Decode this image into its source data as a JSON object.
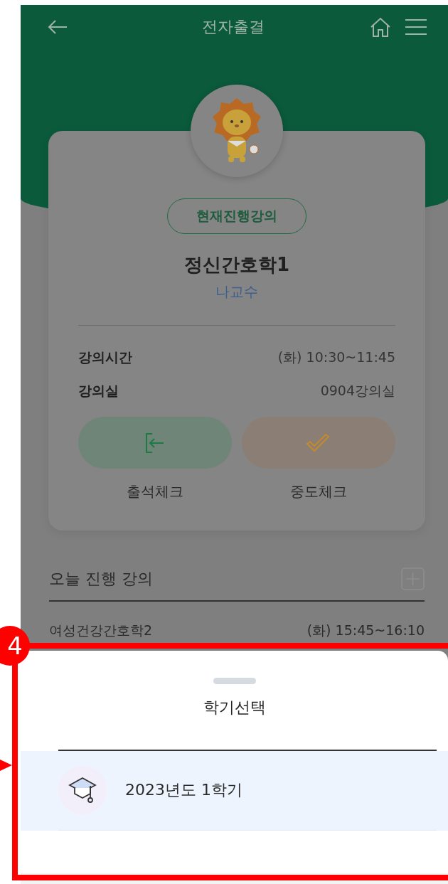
{
  "header": {
    "title": "전자출결"
  },
  "current_lecture": {
    "badge": "현재진행강의",
    "name": "정신간호학1",
    "professor": "나교수",
    "details": [
      {
        "label": "강의시간",
        "value": "(화) 10:30~11:45"
      },
      {
        "label": "강의실",
        "value": "0904강의실"
      }
    ],
    "actions": [
      {
        "kind": "check_in",
        "label": "출석체크"
      },
      {
        "kind": "midway",
        "label": "중도체크"
      }
    ]
  },
  "today": {
    "title": "오늘 진행 강의",
    "lectures": [
      {
        "name": "여성건강간호학2",
        "time": "(화) 15:45~16:10"
      }
    ]
  },
  "semester_sheet": {
    "title": "학기선택",
    "items": [
      {
        "label": "2023년도 1학기",
        "selected": true
      }
    ]
  },
  "annotation": {
    "number": "4"
  }
}
